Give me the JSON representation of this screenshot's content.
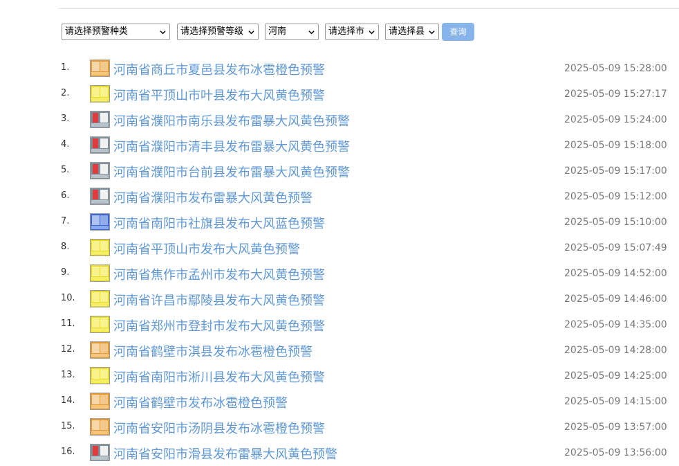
{
  "filters": {
    "type_select": "请选择预警种类",
    "level_select": "请选择预警等级",
    "province_select": "河南",
    "city_select": "请选择市",
    "county_select": "请选择县",
    "query_button": "查询"
  },
  "alerts": [
    {
      "num": "1.",
      "icon": "hail-orange-icon",
      "color": "orange",
      "title": "河南省商丘市夏邑县发布冰雹橙色预警",
      "time": "2025-05-09 15:28:00"
    },
    {
      "num": "2.",
      "icon": "gale-yellow-icon",
      "color": "yellow",
      "title": "河南省平顶山市叶县发布大风黄色预警",
      "time": "2025-05-09 15:27:17"
    },
    {
      "num": "3.",
      "icon": "thunderstorm-gale-alert-icon",
      "color": "gray",
      "title": "河南省濮阳市南乐县发布雷暴大风黄色预警",
      "time": "2025-05-09 15:24:00"
    },
    {
      "num": "4.",
      "icon": "thunderstorm-gale-alert-icon",
      "color": "gray",
      "title": "河南省濮阳市清丰县发布雷暴大风黄色预警",
      "time": "2025-05-09 15:18:00"
    },
    {
      "num": "5.",
      "icon": "thunderstorm-gale-alert-icon",
      "color": "gray",
      "title": "河南省濮阳市台前县发布雷暴大风黄色预警",
      "time": "2025-05-09 15:17:00"
    },
    {
      "num": "6.",
      "icon": "thunderstorm-gale-alert-icon",
      "color": "gray",
      "title": "河南省濮阳市发布雷暴大风黄色预警",
      "time": "2025-05-09 15:12:00"
    },
    {
      "num": "7.",
      "icon": "gale-blue-icon",
      "color": "blue",
      "title": "河南省南阳市社旗县发布大风蓝色预警",
      "time": "2025-05-09 15:10:00"
    },
    {
      "num": "8.",
      "icon": "gale-yellow-icon",
      "color": "yellow",
      "title": "河南省平顶山市发布大风黄色预警",
      "time": "2025-05-09 15:07:49"
    },
    {
      "num": "9.",
      "icon": "gale-yellow-icon",
      "color": "yellow",
      "title": "河南省焦作市孟州市发布大风黄色预警",
      "time": "2025-05-09 14:52:00"
    },
    {
      "num": "10.",
      "icon": "gale-yellow-icon",
      "color": "yellow",
      "title": "河南省许昌市鄢陵县发布大风黄色预警",
      "time": "2025-05-09 14:46:00"
    },
    {
      "num": "11.",
      "icon": "gale-yellow-icon",
      "color": "yellow",
      "title": "河南省郑州市登封市发布大风黄色预警",
      "time": "2025-05-09 14:35:00"
    },
    {
      "num": "12.",
      "icon": "hail-orange-icon",
      "color": "orange",
      "title": "河南省鹤壁市淇县发布冰雹橙色预警",
      "time": "2025-05-09 14:28:00"
    },
    {
      "num": "13.",
      "icon": "gale-yellow-icon",
      "color": "yellow",
      "title": "河南省南阳市淅川县发布大风黄色预警",
      "time": "2025-05-09 14:25:00"
    },
    {
      "num": "14.",
      "icon": "hail-orange-icon",
      "color": "orange",
      "title": "河南省鹤壁市发布冰雹橙色预警",
      "time": "2025-05-09 14:15:00"
    },
    {
      "num": "15.",
      "icon": "hail-orange-icon",
      "color": "orange",
      "title": "河南省安阳市汤阴县发布冰雹橙色预警",
      "time": "2025-05-09 13:57:00"
    },
    {
      "num": "16.",
      "icon": "thunderstorm-gale-alert-icon",
      "color": "gray",
      "title": "河南省安阳市滑县发布雷暴大风黄色预警",
      "time": "2025-05-09 13:56:00"
    }
  ]
}
